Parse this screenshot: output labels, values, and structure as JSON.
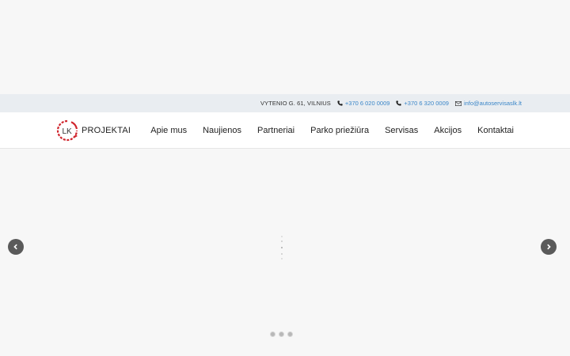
{
  "topbar": {
    "address": "VYTENIO G. 61, VILNIUS",
    "phone1": "+370 6 020 0009",
    "phone2": "+370 6 320 0009",
    "email": "info@autoservisaslk.lt",
    "link_color": "#3a86c8"
  },
  "logo": {
    "mark_text": "LK",
    "text": "PROJEKTAI",
    "accent_color": "#d0262e"
  },
  "nav": {
    "items": [
      "Apie mus",
      "Naujienos",
      "Partneriai",
      "Parko priežiūra",
      "Servisas",
      "Akcijos",
      "Kontaktai"
    ]
  },
  "slider": {
    "prev_icon": "chevron-left-icon",
    "next_icon": "chevron-right-icon",
    "slide_count": 3,
    "loading": true
  }
}
